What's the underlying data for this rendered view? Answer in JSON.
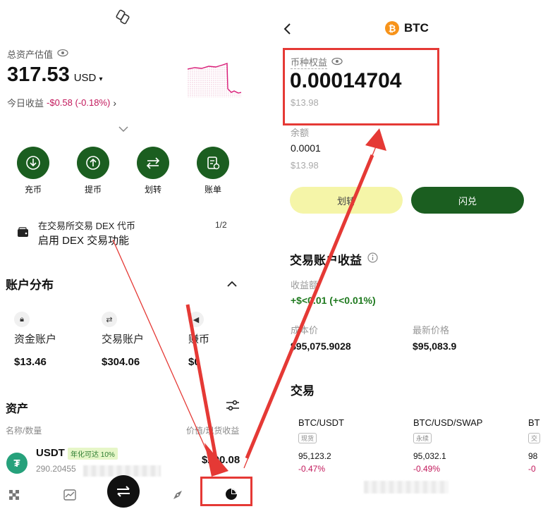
{
  "left": {
    "total_assets_label": "总资产估值",
    "total_value": "317.53",
    "currency": "USD",
    "today_pnl_label": "今日收益",
    "today_pnl_value": "-$0.58 (-0.18%)",
    "actions": [
      {
        "label": "充币",
        "icon": "deposit-icon"
      },
      {
        "label": "提币",
        "icon": "withdraw-icon"
      },
      {
        "label": "划转",
        "icon": "transfer-icon"
      },
      {
        "label": "账单",
        "icon": "bill-icon"
      }
    ],
    "banner": {
      "line1": "在交易所交易 DEX 代币",
      "line2": "启用 DEX 交易功能",
      "pager": "1/2"
    },
    "distribution_title": "账户分布",
    "accounts": [
      {
        "name": "资金账户",
        "value": "$13.46"
      },
      {
        "name": "交易账户",
        "value": "$304.06"
      },
      {
        "name": "赚币",
        "value": "$0"
      }
    ],
    "assets_title": "资产",
    "assets_col_left": "名称/数量",
    "assets_col_right": "价值/现货收益",
    "usdt": {
      "name": "USDT",
      "tag": "年化可达 10%",
      "amount": "290.20455",
      "value": "$290.08"
    }
  },
  "right": {
    "coin": "BTC",
    "equity_label": "币种权益",
    "equity_value": "0.00014704",
    "equity_usd": "$13.98",
    "balance_label": "余额",
    "balance_value": "0.0001",
    "balance_usd": "$13.98",
    "transfer_btn": "划转",
    "swap_btn": "闪兑",
    "pnl_title": "交易账户收益",
    "pnl_amount_label": "收益额",
    "pnl_amount_value": "+$<0.01 (+<0.01%)",
    "cost_label": "成本价",
    "cost_value": "$95,075.9028",
    "latest_label": "最新价格",
    "latest_value": "$95,083.9",
    "trade_title": "交易",
    "pairs": [
      {
        "name": "BTC/USDT",
        "tag": "现货",
        "price": "95,123.2",
        "change": "-0.47%"
      },
      {
        "name": "BTC/USD/SWAP",
        "tag": "永续",
        "price": "95,032.1",
        "change": "-0.49%"
      },
      {
        "name": "BT",
        "tag": "交",
        "price": "98",
        "change": "-0"
      }
    ]
  },
  "colors": {
    "accent_green": "#1b5e20",
    "loss_red": "#c2185b",
    "annotation_red": "#e53935",
    "transfer_yellow": "#f5f5a8"
  }
}
